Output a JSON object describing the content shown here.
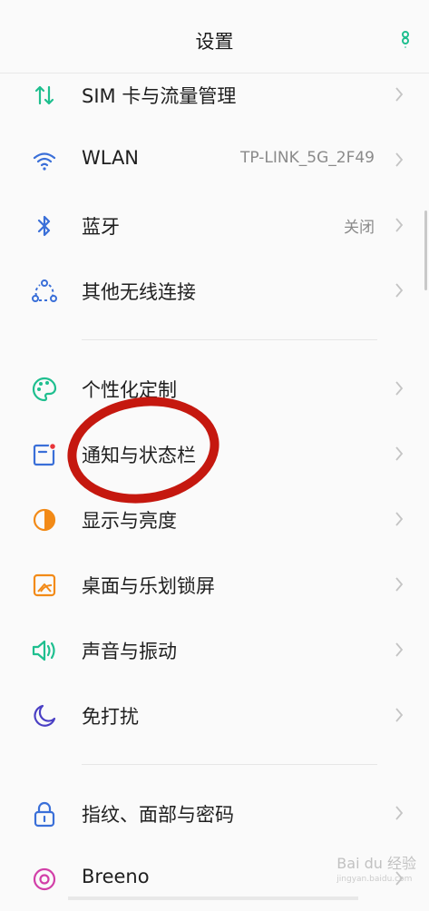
{
  "header": {
    "title": "设置"
  },
  "rows": [
    {
      "label": "SIM 卡与流量管理",
      "value": ""
    },
    {
      "label": "WLAN",
      "value": "TP-LINK_5G_2F49"
    },
    {
      "label": "蓝牙",
      "value": "关闭"
    },
    {
      "label": "其他无线连接",
      "value": ""
    },
    {
      "label": "个性化定制",
      "value": ""
    },
    {
      "label": "通知与状态栏",
      "value": ""
    },
    {
      "label": "显示与亮度",
      "value": ""
    },
    {
      "label": "桌面与乐划锁屏",
      "value": ""
    },
    {
      "label": "声音与振动",
      "value": ""
    },
    {
      "label": "免打扰",
      "value": ""
    },
    {
      "label": "指纹、面部与密码",
      "value": ""
    },
    {
      "label": "Breeno",
      "value": ""
    }
  ],
  "watermark": {
    "text": "Bai du 经验",
    "sub": "jingyan.baidu.com"
  },
  "colors": {
    "accent": "#1fbf8f",
    "annotation": "#c5180f"
  }
}
